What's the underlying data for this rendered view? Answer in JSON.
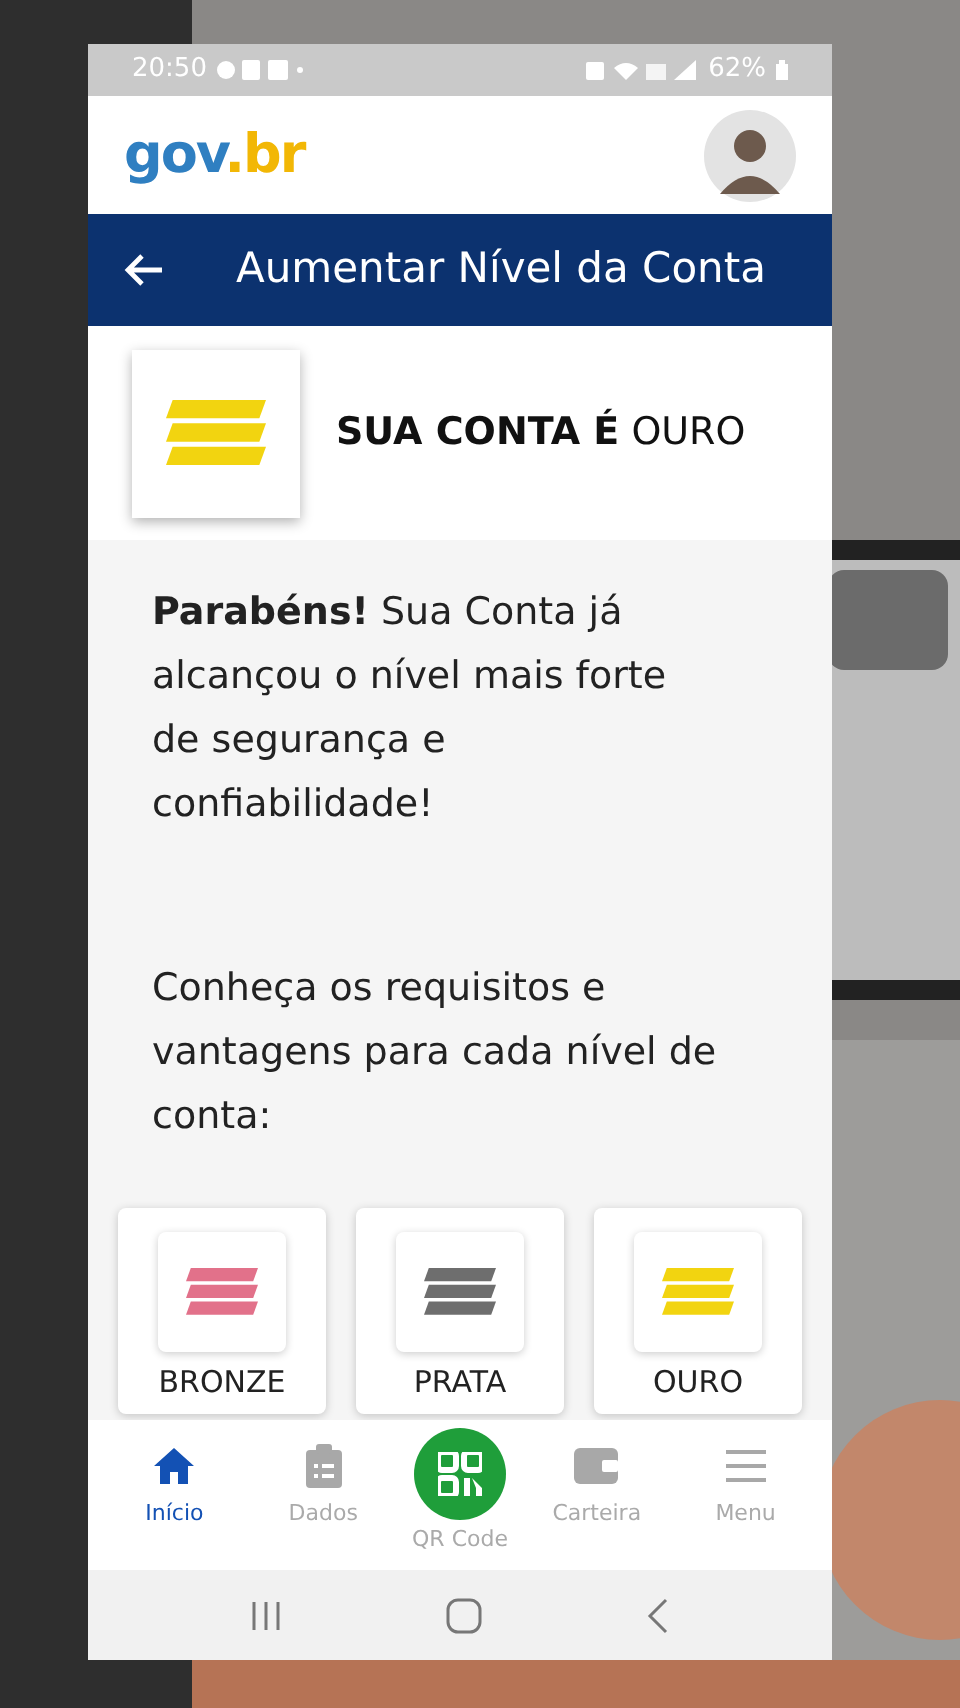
{
  "status_bar": {
    "time": "20:50",
    "battery": "62%"
  },
  "header": {
    "logo": {
      "part_1": "gov",
      "part_2": ".br"
    }
  },
  "app_bar": {
    "title": "Aumentar Nível da Conta"
  },
  "account_level": {
    "prefix": "SUA CONTA É",
    "level": "OURO",
    "color": "#f2d410"
  },
  "message": "**Parabéns!** Sua Conta já alcançou o nível mais forte de segurança e confiabilidade!",
  "intro": "Conheça os requisitos e vantagens para cada nível de conta:",
  "levels": [
    {
      "label": "BRONZE",
      "color": "#e2718a"
    },
    {
      "label": "PRATA",
      "color": "#6e6e6e"
    },
    {
      "label": "OURO",
      "color": "#f2d410"
    }
  ],
  "bottom_nav": [
    {
      "kind": "tab",
      "label": "Início",
      "selected": true
    },
    {
      "kind": "tab",
      "label": "Dados",
      "selected": false
    },
    {
      "kind": "qr",
      "label": "QR Code",
      "selected": false
    },
    {
      "kind": "tab",
      "label": "Carteira",
      "selected": false
    },
    {
      "kind": "tab",
      "label": "Menu",
      "selected": false
    }
  ]
}
